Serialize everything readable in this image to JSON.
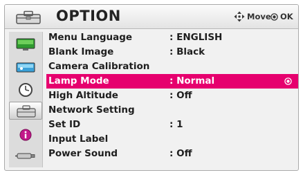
{
  "header": {
    "title": "OPTION",
    "title_icon": "option-toolbox-icon",
    "hints": [
      {
        "icon": "four-way-arrow-icon",
        "label": "Move"
      },
      {
        "icon": "ok-dot-icon",
        "label": "OK"
      }
    ]
  },
  "sidebar": {
    "items": [
      {
        "icon": "picture-monitor-icon",
        "active": false
      },
      {
        "icon": "screen-picture-icon",
        "active": false
      },
      {
        "icon": "clock-icon",
        "active": false
      },
      {
        "icon": "option-toolbox-icon",
        "active": true
      },
      {
        "icon": "info-icon",
        "active": false
      },
      {
        "icon": "input-connector-icon",
        "active": false
      }
    ]
  },
  "menu": {
    "items": [
      {
        "label": "Menu Language",
        "value": ": ENGLISH"
      },
      {
        "label": "Blank Image",
        "value": ": Black"
      },
      {
        "label": "Camera Calibration",
        "value": ""
      },
      {
        "label": "Lamp Mode",
        "value": ": Normal",
        "selected": true
      },
      {
        "label": "High Altitude",
        "value": ": Off"
      },
      {
        "label": "Network Setting",
        "value": ""
      },
      {
        "label": "Set ID",
        "value": ": 1"
      },
      {
        "label": "Input Label",
        "value": ""
      },
      {
        "label": "Power Sound",
        "value": ": Off"
      }
    ]
  },
  "colors": {
    "selection": "#e6006e",
    "info_icon": "#c2188a",
    "clock_border": "#444444"
  }
}
